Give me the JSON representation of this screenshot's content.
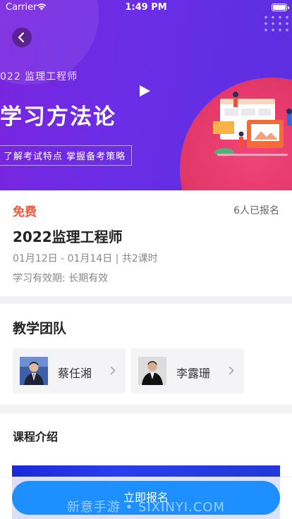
{
  "status_bar": {
    "carrier": "Carrier",
    "time": "1:49 PM"
  },
  "banner": {
    "small_title": "022 监理工程师",
    "big_title": "学习方法论",
    "tagline": "了解考试特点 掌握备考策略"
  },
  "course": {
    "price": "免费",
    "enrolled": "6人已报名",
    "title": "2022监理工程师",
    "dates": "01月12日 - 01月14日 | 共2课时",
    "validity": "学习有效期: 长期有效"
  },
  "team": {
    "title": "教学团队",
    "teachers": [
      {
        "name": "蔡任湘"
      },
      {
        "name": "李露珊"
      }
    ]
  },
  "intro": {
    "title": "课程介绍"
  },
  "cta": {
    "label": "立即报名"
  },
  "watermark": "新意手游 • SIXINYI.COM",
  "colors": {
    "accent": "#1d8fff",
    "price": "#f4573a",
    "banner": "#6a2ee6"
  }
}
